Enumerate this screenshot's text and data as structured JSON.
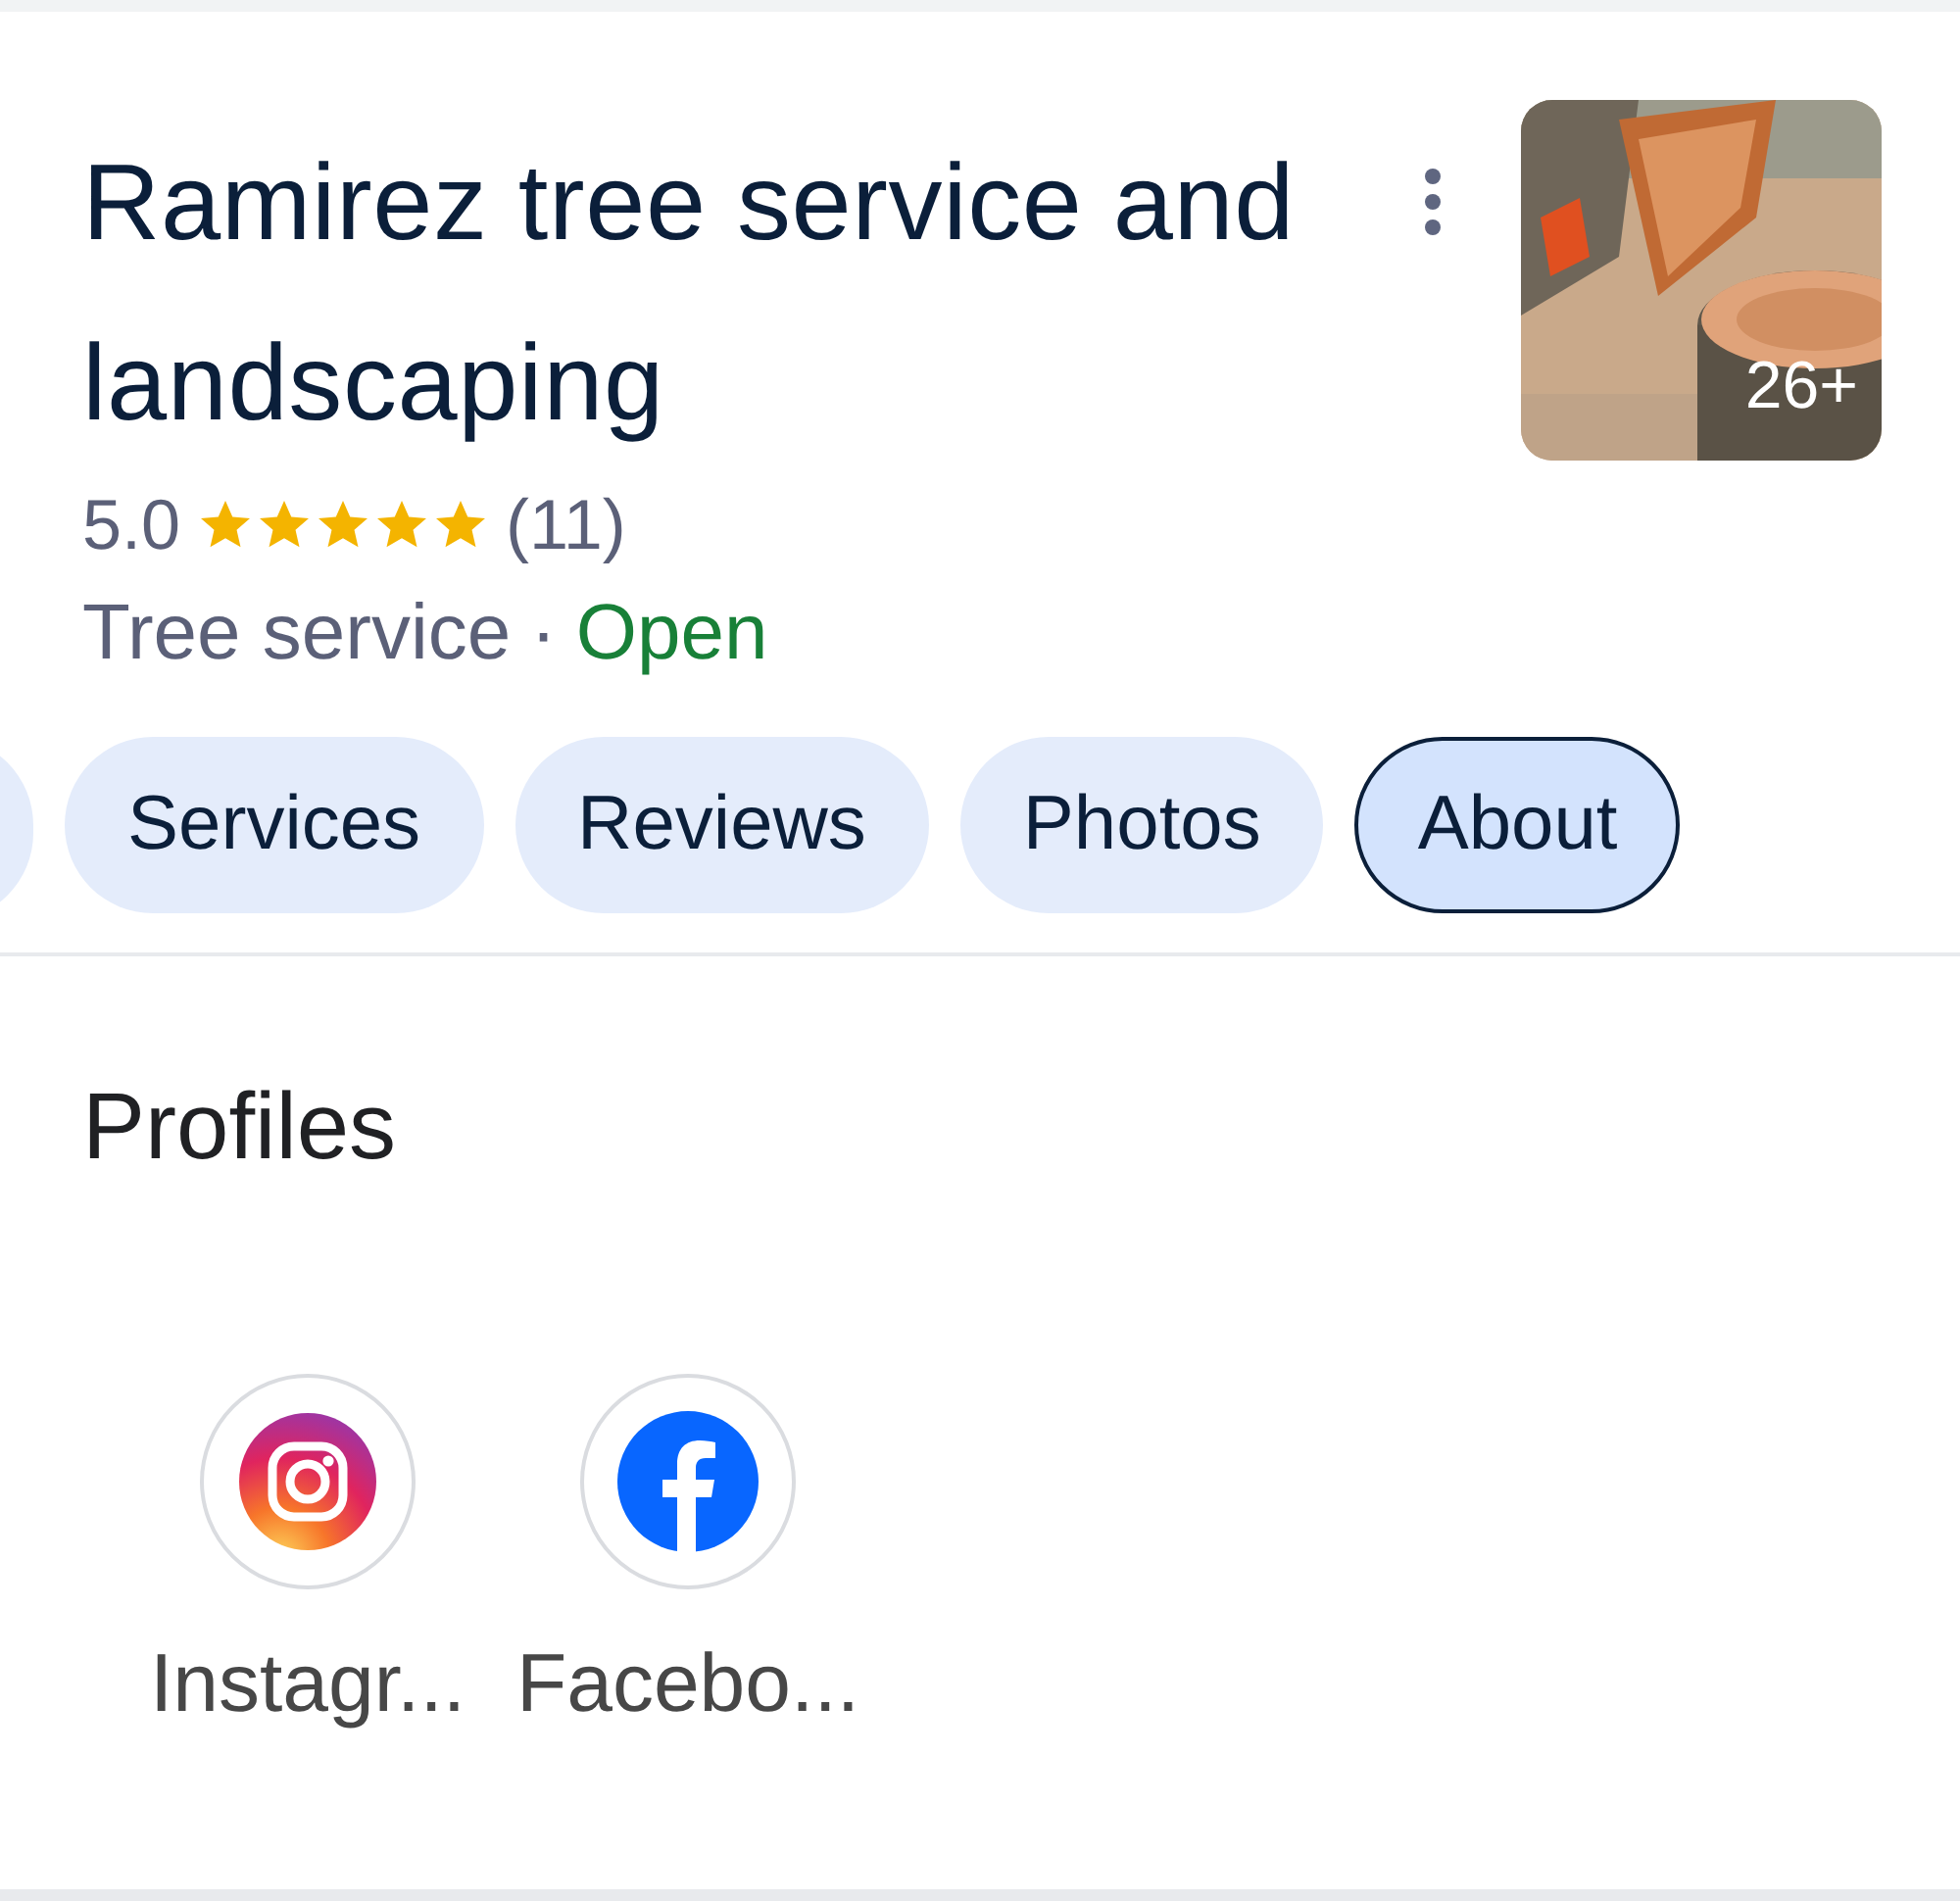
{
  "place": {
    "title": "Ramirez tree service and landscaping",
    "photo_count": "26+",
    "rating": "5.0",
    "stars": 5,
    "review_count": "(11)",
    "category": "Tree service",
    "separator": "·",
    "status": "Open"
  },
  "tabs": [
    {
      "label": "Services",
      "selected": false
    },
    {
      "label": "Reviews",
      "selected": false
    },
    {
      "label": "Photos",
      "selected": false
    },
    {
      "label": "About",
      "selected": true
    }
  ],
  "profiles": {
    "heading": "Profiles",
    "items": [
      {
        "kind": "instagram",
        "label": "Instagr..."
      },
      {
        "kind": "facebook",
        "label": "Facebo..."
      }
    ]
  }
}
